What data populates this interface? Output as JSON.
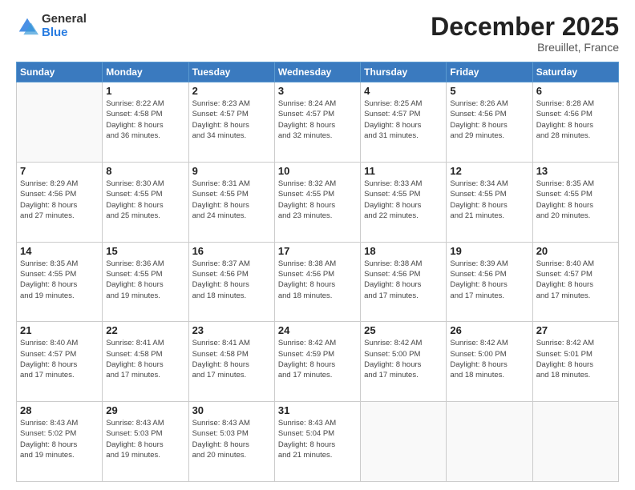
{
  "header": {
    "logo_general": "General",
    "logo_blue": "Blue",
    "month_title": "December 2025",
    "subtitle": "Breuillet, France"
  },
  "days_of_week": [
    "Sunday",
    "Monday",
    "Tuesday",
    "Wednesday",
    "Thursday",
    "Friday",
    "Saturday"
  ],
  "weeks": [
    [
      {
        "day": "",
        "info": ""
      },
      {
        "day": "1",
        "info": "Sunrise: 8:22 AM\nSunset: 4:58 PM\nDaylight: 8 hours\nand 36 minutes."
      },
      {
        "day": "2",
        "info": "Sunrise: 8:23 AM\nSunset: 4:57 PM\nDaylight: 8 hours\nand 34 minutes."
      },
      {
        "day": "3",
        "info": "Sunrise: 8:24 AM\nSunset: 4:57 PM\nDaylight: 8 hours\nand 32 minutes."
      },
      {
        "day": "4",
        "info": "Sunrise: 8:25 AM\nSunset: 4:57 PM\nDaylight: 8 hours\nand 31 minutes."
      },
      {
        "day": "5",
        "info": "Sunrise: 8:26 AM\nSunset: 4:56 PM\nDaylight: 8 hours\nand 29 minutes."
      },
      {
        "day": "6",
        "info": "Sunrise: 8:28 AM\nSunset: 4:56 PM\nDaylight: 8 hours\nand 28 minutes."
      }
    ],
    [
      {
        "day": "7",
        "info": "Sunrise: 8:29 AM\nSunset: 4:56 PM\nDaylight: 8 hours\nand 27 minutes."
      },
      {
        "day": "8",
        "info": "Sunrise: 8:30 AM\nSunset: 4:55 PM\nDaylight: 8 hours\nand 25 minutes."
      },
      {
        "day": "9",
        "info": "Sunrise: 8:31 AM\nSunset: 4:55 PM\nDaylight: 8 hours\nand 24 minutes."
      },
      {
        "day": "10",
        "info": "Sunrise: 8:32 AM\nSunset: 4:55 PM\nDaylight: 8 hours\nand 23 minutes."
      },
      {
        "day": "11",
        "info": "Sunrise: 8:33 AM\nSunset: 4:55 PM\nDaylight: 8 hours\nand 22 minutes."
      },
      {
        "day": "12",
        "info": "Sunrise: 8:34 AM\nSunset: 4:55 PM\nDaylight: 8 hours\nand 21 minutes."
      },
      {
        "day": "13",
        "info": "Sunrise: 8:35 AM\nSunset: 4:55 PM\nDaylight: 8 hours\nand 20 minutes."
      }
    ],
    [
      {
        "day": "14",
        "info": "Sunrise: 8:35 AM\nSunset: 4:55 PM\nDaylight: 8 hours\nand 19 minutes."
      },
      {
        "day": "15",
        "info": "Sunrise: 8:36 AM\nSunset: 4:55 PM\nDaylight: 8 hours\nand 19 minutes."
      },
      {
        "day": "16",
        "info": "Sunrise: 8:37 AM\nSunset: 4:56 PM\nDaylight: 8 hours\nand 18 minutes."
      },
      {
        "day": "17",
        "info": "Sunrise: 8:38 AM\nSunset: 4:56 PM\nDaylight: 8 hours\nand 18 minutes."
      },
      {
        "day": "18",
        "info": "Sunrise: 8:38 AM\nSunset: 4:56 PM\nDaylight: 8 hours\nand 17 minutes."
      },
      {
        "day": "19",
        "info": "Sunrise: 8:39 AM\nSunset: 4:56 PM\nDaylight: 8 hours\nand 17 minutes."
      },
      {
        "day": "20",
        "info": "Sunrise: 8:40 AM\nSunset: 4:57 PM\nDaylight: 8 hours\nand 17 minutes."
      }
    ],
    [
      {
        "day": "21",
        "info": "Sunrise: 8:40 AM\nSunset: 4:57 PM\nDaylight: 8 hours\nand 17 minutes."
      },
      {
        "day": "22",
        "info": "Sunrise: 8:41 AM\nSunset: 4:58 PM\nDaylight: 8 hours\nand 17 minutes."
      },
      {
        "day": "23",
        "info": "Sunrise: 8:41 AM\nSunset: 4:58 PM\nDaylight: 8 hours\nand 17 minutes."
      },
      {
        "day": "24",
        "info": "Sunrise: 8:42 AM\nSunset: 4:59 PM\nDaylight: 8 hours\nand 17 minutes."
      },
      {
        "day": "25",
        "info": "Sunrise: 8:42 AM\nSunset: 5:00 PM\nDaylight: 8 hours\nand 17 minutes."
      },
      {
        "day": "26",
        "info": "Sunrise: 8:42 AM\nSunset: 5:00 PM\nDaylight: 8 hours\nand 18 minutes."
      },
      {
        "day": "27",
        "info": "Sunrise: 8:42 AM\nSunset: 5:01 PM\nDaylight: 8 hours\nand 18 minutes."
      }
    ],
    [
      {
        "day": "28",
        "info": "Sunrise: 8:43 AM\nSunset: 5:02 PM\nDaylight: 8 hours\nand 19 minutes."
      },
      {
        "day": "29",
        "info": "Sunrise: 8:43 AM\nSunset: 5:03 PM\nDaylight: 8 hours\nand 19 minutes."
      },
      {
        "day": "30",
        "info": "Sunrise: 8:43 AM\nSunset: 5:03 PM\nDaylight: 8 hours\nand 20 minutes."
      },
      {
        "day": "31",
        "info": "Sunrise: 8:43 AM\nSunset: 5:04 PM\nDaylight: 8 hours\nand 21 minutes."
      },
      {
        "day": "",
        "info": ""
      },
      {
        "day": "",
        "info": ""
      },
      {
        "day": "",
        "info": ""
      }
    ]
  ]
}
